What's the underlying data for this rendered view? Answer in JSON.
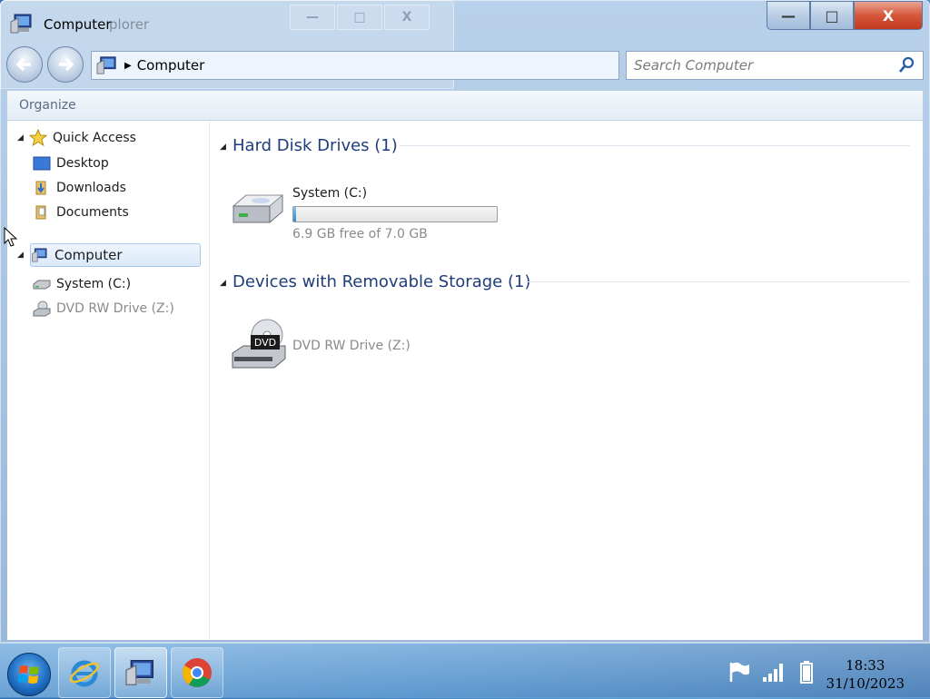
{
  "window": {
    "title": "Computer",
    "ghost_title_fragment": "plorer",
    "ghost_buttons": [
      "—",
      "□",
      "X"
    ],
    "caption": {
      "minimize": "—",
      "maximize": "□",
      "close": "X"
    }
  },
  "navigation": {
    "address_root_icon": "computer-icon",
    "address_path": "Computer",
    "search_placeholder": "Search Computer"
  },
  "toolbar": {
    "organize_label": "Organize"
  },
  "sidebar": {
    "quick_access": {
      "label": "Quick Access",
      "items": [
        {
          "label": "Desktop",
          "icon": "desktop-icon"
        },
        {
          "label": "Downloads",
          "icon": "downloads-folder-icon"
        },
        {
          "label": "Documents",
          "icon": "documents-folder-icon"
        }
      ]
    },
    "computer": {
      "label": "Computer",
      "items": [
        {
          "label": "System (C:)",
          "icon": "hard-drive-icon"
        },
        {
          "label": "DVD RW Drive (Z:)",
          "icon": "dvd-drive-icon"
        }
      ]
    }
  },
  "main": {
    "hard_disk_section": {
      "title": "Hard Disk Drives (1)",
      "drive": {
        "name": "System (C:)",
        "free_text": "6.9 GB free of 7.0 GB",
        "used_fraction": 0.014
      }
    },
    "removable_section": {
      "title": "Devices with Removable Storage (1)",
      "drive": {
        "name": "DVD RW Drive (Z:)",
        "badge": "DVD"
      }
    }
  },
  "taskbar": {
    "pinned": [
      "internet-explorer-icon",
      "windows-explorer-icon",
      "chrome-icon"
    ],
    "tray": [
      "action-center-flag-icon",
      "network-signal-icon",
      "battery-icon"
    ],
    "time": "18:33",
    "date": "31/10/2023"
  },
  "colors": {
    "section_heading": "#1e3d7a",
    "close_button": "#c23a1e",
    "accent": "#2b8ad6"
  }
}
